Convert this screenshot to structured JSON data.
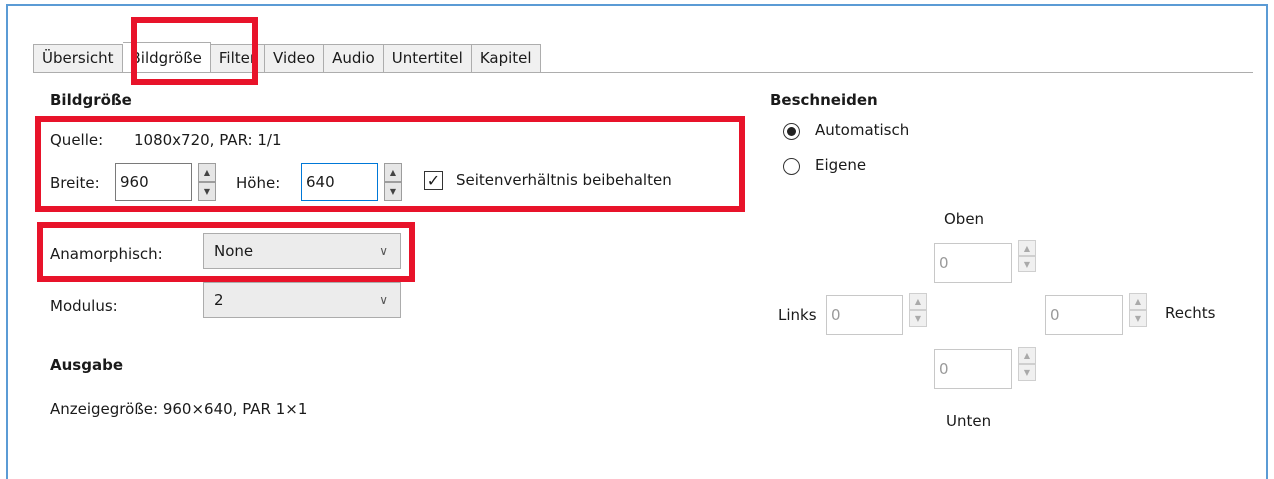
{
  "tabs": [
    "Übersicht",
    "Bildgröße",
    "Filter",
    "Video",
    "Audio",
    "Untertitel",
    "Kapitel"
  ],
  "size": {
    "heading": "Bildgröße",
    "source_label": "Quelle:",
    "source_value": "1080x720, PAR: 1/1",
    "width_label": "Breite:",
    "width_value": "960",
    "height_label": "Höhe:",
    "height_value": "640",
    "keep_ratio_label": "Seitenverhältnis beibehalten",
    "keep_ratio_checked": true,
    "anamorphic_label": "Anamorphisch:",
    "anamorphic_value": "None",
    "modulus_label": "Modulus:",
    "modulus_value": "2"
  },
  "output": {
    "heading": "Ausgabe",
    "display_size": "Anzeigegröße: 960×640, PAR 1×1"
  },
  "crop": {
    "heading": "Beschneiden",
    "auto_label": "Automatisch",
    "custom_label": "Eigene",
    "selected": "Automatisch",
    "top_label": "Oben",
    "top_value": "0",
    "left_label": "Links",
    "left_value": "0",
    "right_label": "Rechts",
    "right_value": "0",
    "bottom_label": "Unten",
    "bottom_value": "0"
  },
  "icons": {
    "spin_up": "▲",
    "spin_down": "▼",
    "chevron": "∨",
    "check": "✓"
  },
  "colors": {
    "highlight": "#e8132a",
    "frame": "#5b9bd5"
  }
}
